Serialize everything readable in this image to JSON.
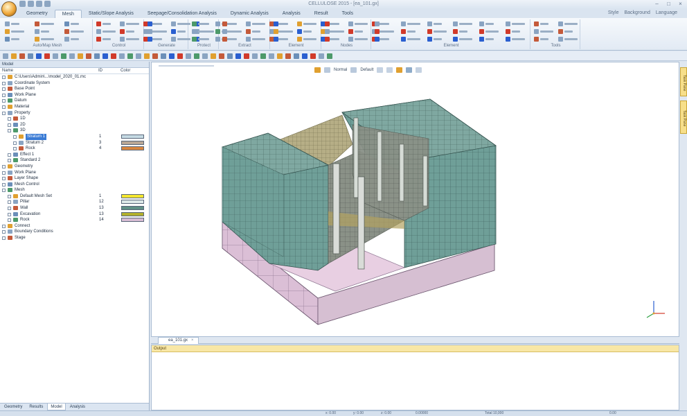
{
  "window": {
    "title": "CELLULOSE 2015 - [ea_101.gx]",
    "controls": [
      "–",
      "□",
      "×"
    ]
  },
  "help_links": [
    "Style",
    "Background",
    "Language"
  ],
  "ribbon": {
    "tabs": [
      "Geometry",
      "Mesh",
      "Static/Slope Analysis",
      "Seepage/Consolidation Analysis",
      "Dynamic Analysis",
      "Analysis",
      "Result",
      "Tools"
    ],
    "active_tab": "Mesh",
    "groups": [
      "Auto/Map Mesh",
      "Control",
      "Generate",
      "Protect",
      "Extract",
      "Element",
      "Nodes",
      "Element",
      "Tools"
    ]
  },
  "left_panel": {
    "title": "Model",
    "columns": [
      "Name",
      "ID",
      "Color"
    ],
    "rows": [
      {
        "label": "C:\\Users\\Admin\\...\\model_2020_01.mc",
        "depth": 0,
        "id": "",
        "color": ""
      },
      {
        "label": "Coordinate System",
        "depth": 0,
        "id": "",
        "color": ""
      },
      {
        "label": "Base Point",
        "depth": 0,
        "id": "",
        "color": ""
      },
      {
        "label": "Work Plane",
        "depth": 0,
        "id": "",
        "color": ""
      },
      {
        "label": "Datum",
        "depth": 0,
        "id": "",
        "color": ""
      },
      {
        "label": "Material",
        "depth": 0,
        "id": "",
        "color": ""
      },
      {
        "label": "Property",
        "depth": 0,
        "id": "",
        "color": ""
      },
      {
        "label": "1D",
        "depth": 1,
        "id": "",
        "color": ""
      },
      {
        "label": "2D",
        "depth": 1,
        "id": "",
        "color": ""
      },
      {
        "label": "3D",
        "depth": 1,
        "id": "",
        "color": ""
      },
      {
        "label": "Stratum 1",
        "depth": 2,
        "id": "1",
        "color": "#c6dbe4",
        "selected": true
      },
      {
        "label": "Stratum 2",
        "depth": 2,
        "id": "3",
        "color": "#b8a796"
      },
      {
        "label": "Rock",
        "depth": 2,
        "id": "4",
        "color": "#d8863f"
      },
      {
        "label": "Effect 1",
        "depth": 1,
        "id": "",
        "color": ""
      },
      {
        "label": "Standard 2",
        "depth": 1,
        "id": "",
        "color": ""
      },
      {
        "label": "Geometry",
        "depth": 0,
        "id": "",
        "color": ""
      },
      {
        "label": "Work Plane",
        "depth": 0,
        "id": "",
        "color": ""
      },
      {
        "label": "Layer Shape",
        "depth": 0,
        "id": "",
        "color": ""
      },
      {
        "label": "Mesh Control",
        "depth": 0,
        "id": "",
        "color": ""
      },
      {
        "label": "Mesh",
        "depth": 0,
        "id": "",
        "color": ""
      },
      {
        "label": "Default Mesh Set",
        "depth": 1,
        "id": "1",
        "color": "#f5e72e"
      },
      {
        "label": "Pillar",
        "depth": 1,
        "id": "12",
        "color": "#dce8e8"
      },
      {
        "label": "Wall",
        "depth": 1,
        "id": "13",
        "color": "#5f8f86"
      },
      {
        "label": "Excavation",
        "depth": 1,
        "id": "13",
        "color": "#b3b02c"
      },
      {
        "label": "Rock",
        "depth": 1,
        "id": "14",
        "color": "#d7bcd3"
      },
      {
        "label": "Connect",
        "depth": 0,
        "id": "",
        "color": ""
      },
      {
        "label": "Boundary Conditions",
        "depth": 0,
        "id": "",
        "color": ""
      },
      {
        "label": "Stage",
        "depth": 0,
        "id": "",
        "color": ""
      }
    ],
    "bottom_tabs": [
      "Geometry",
      "Results",
      "Model",
      "Analysis"
    ],
    "active_bottom_tab": "Model"
  },
  "viewport": {
    "toolbar": [
      "Normal",
      "Default",
      "Iso"
    ],
    "doc_tab": "ea_101.gx"
  },
  "side_tabs": [
    "Task Pane",
    "Task Pane"
  ],
  "output_panel": {
    "title": "Output"
  },
  "status_bar": {
    "items": [
      "x: 0.00",
      "y: 0.00",
      "z: 0.00",
      "0.00000",
      "Total 10,000",
      "0.00"
    ]
  }
}
